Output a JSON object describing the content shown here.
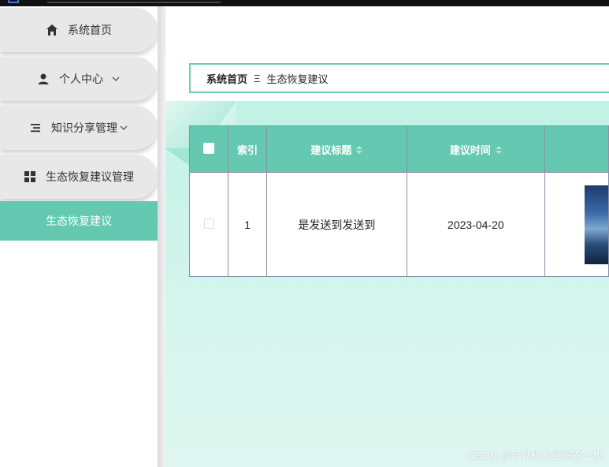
{
  "sidebar": {
    "items": [
      {
        "label": "系统首页",
        "icon": "home-icon"
      },
      {
        "label": "个人中心",
        "icon": "user-icon",
        "expandable": true
      },
      {
        "label": "知识分享管理",
        "icon": "list-icon",
        "expandable": true
      },
      {
        "label": "生态恢复建议管理",
        "icon": "grid-icon",
        "expandable": false
      }
    ],
    "active_sub_item": "生态恢复建议"
  },
  "breadcrumb": {
    "home": "系统首页",
    "separator": "Ξ",
    "current": "生态恢复建议"
  },
  "table": {
    "columns": [
      "索引",
      "建议标题",
      "建议时间"
    ],
    "rows": [
      {
        "index": "1",
        "title": "是发送到发送到",
        "time": "2023-04-20"
      }
    ]
  },
  "watermark": "CSDN @计算机专业码农一枚",
  "colors": {
    "accent": "#64c9b0",
    "breadcrumb_border": "#6ecdb6",
    "pill_bg": "#e8e8e8"
  }
}
